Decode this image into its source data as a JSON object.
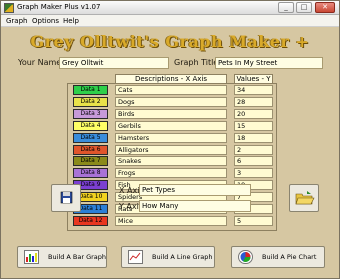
{
  "window": {
    "title": "Graph Maker Plus v1.07",
    "controls": {
      "minimize": "_",
      "maximize": "□",
      "close": "✕"
    }
  },
  "menu": [
    "Graph",
    "Options",
    "Help"
  ],
  "banner": "Grey Olltwit's Graph Maker +",
  "form": {
    "name_label": "Your Name:",
    "name_value": "Grey Olltwit",
    "title_label": "Graph Title:",
    "title_value": "Pets In My Street",
    "desc_header": "Descriptions - X Axis",
    "values_header": "Values - Y",
    "x_axis_label": "X Axis Label:",
    "x_axis_value": "Pet Types",
    "y_axis_label": "Y Axis Label:",
    "y_axis_value": "How Many"
  },
  "rows": [
    {
      "label": "Data 1",
      "color": "#2ecf4a",
      "desc": "Cats",
      "value": "34"
    },
    {
      "label": "Data 2",
      "color": "#e8e24a",
      "desc": "Dogs",
      "value": "28"
    },
    {
      "label": "Data 3",
      "color": "#c79ad9",
      "desc": "Birds",
      "value": "20"
    },
    {
      "label": "Data 4",
      "color": "#ffff66",
      "desc": "Gerbils",
      "value": "15"
    },
    {
      "label": "Data 5",
      "color": "#3a8ddb",
      "desc": "Hamsters",
      "value": "18"
    },
    {
      "label": "Data 6",
      "color": "#e0552b",
      "desc": "Alligators",
      "value": "2"
    },
    {
      "label": "Data 7",
      "color": "#8a8a1a",
      "desc": "Snakes",
      "value": "6"
    },
    {
      "label": "Data 8",
      "color": "#a872d6",
      "desc": "Frogs",
      "value": "3"
    },
    {
      "label": "Data 9",
      "color": "#7b3fd1",
      "desc": "Fish",
      "value": "19"
    },
    {
      "label": "Data 10",
      "color": "#f2d21f",
      "desc": "Spiders",
      "value": "7"
    },
    {
      "label": "Data 11",
      "color": "#2b7fd6",
      "desc": "Rats",
      "value": "12"
    },
    {
      "label": "Data 12",
      "color": "#e8361f",
      "desc": "Mice",
      "value": "5"
    }
  ],
  "buttons": {
    "save_icon": "floppy-disk-icon",
    "open_icon": "open-folder-icon",
    "bar_graph": "Build A Bar Graph",
    "line_graph": "Build A Line Graph",
    "pie_chart": "Build A Pie Chart"
  }
}
